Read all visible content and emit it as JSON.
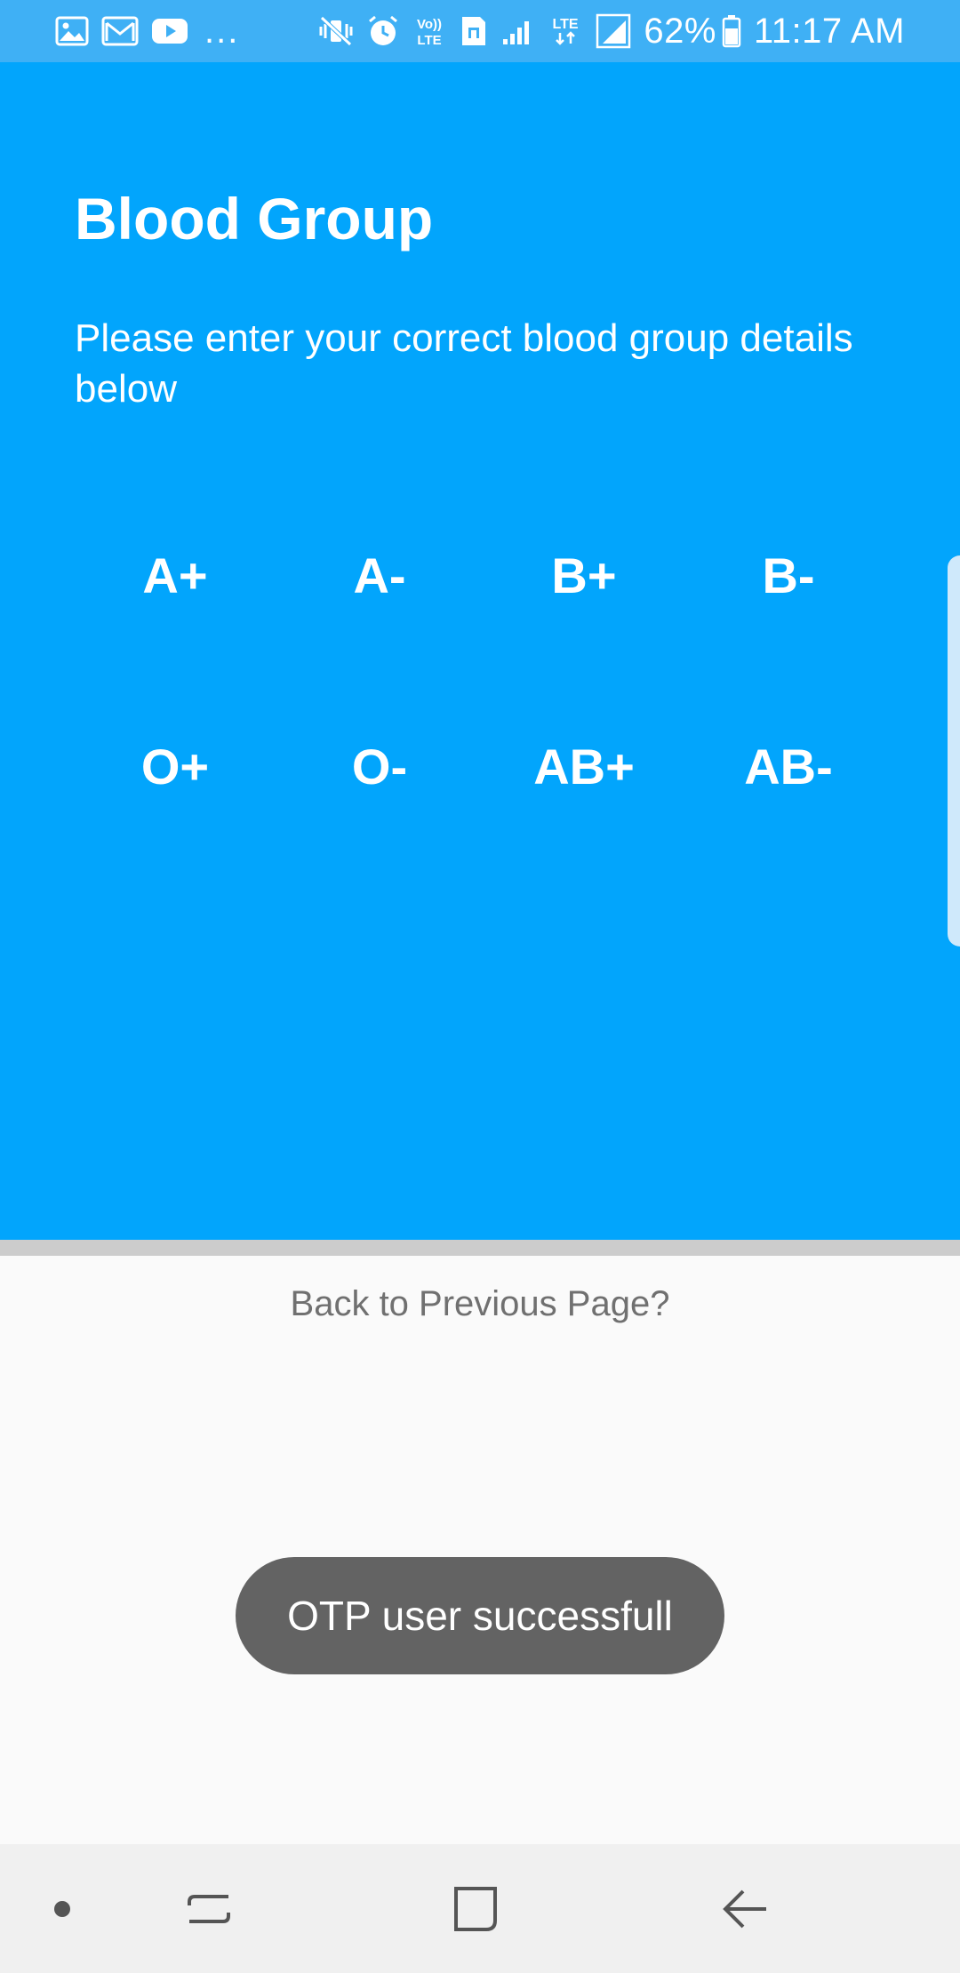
{
  "status_bar": {
    "left_icons": [
      "gallery-icon",
      "gmail-icon",
      "youtube-icon"
    ],
    "overflow": "...",
    "right_icons": [
      "mute-vibrate-icon",
      "alarm-icon",
      "volte-icon",
      "sim-icon",
      "signal-icon",
      "lte-icon",
      "signal-2-icon",
      "battery-icon"
    ],
    "volte_label": "Vo)) LTE",
    "lte_label": "LTE",
    "battery": "62%",
    "time": "11:17 AM"
  },
  "page": {
    "title": "Blood Group",
    "subtitle": "Please enter your correct blood group details below"
  },
  "blood_groups": [
    "A+",
    "A-",
    "B+",
    "B-",
    "O+",
    "O-",
    "AB+",
    "AB-"
  ],
  "footer": {
    "back_link": "Back to Previous Page?"
  },
  "toast": {
    "message": "OTP user successfull"
  },
  "nav_bar": {
    "buttons": [
      "dot-icon",
      "recent-apps-icon",
      "home-icon",
      "back-icon"
    ]
  },
  "colors": {
    "primary": "#02a5fc",
    "status_bar": "#3fb0f5",
    "toast_bg": "#636363"
  }
}
